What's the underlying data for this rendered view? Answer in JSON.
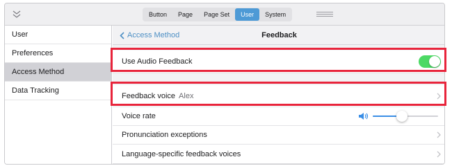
{
  "toolbar": {
    "segments": [
      "Button",
      "Page",
      "Page Set",
      "User",
      "System"
    ],
    "active_segment": "User"
  },
  "sidebar": {
    "items": [
      {
        "label": "User"
      },
      {
        "label": "Preferences"
      },
      {
        "label": "Access Method"
      },
      {
        "label": "Data Tracking"
      }
    ],
    "selected": "Access Method"
  },
  "nav": {
    "back_label": "Access Method",
    "title": "Feedback"
  },
  "settings": {
    "audio_feedback": {
      "label": "Use Audio Feedback",
      "enabled": true
    },
    "feedback_voice": {
      "label": "Feedback voice",
      "value": "Alex"
    },
    "voice_rate": {
      "label": "Voice rate",
      "level": 0.45
    },
    "pronunciation": {
      "label": "Pronunciation exceptions"
    },
    "language_voices": {
      "label": "Language-specific feedback voices"
    }
  },
  "colors": {
    "accent": "#4d9ad6",
    "toggle_on": "#4cd964",
    "highlight": "#e8243b"
  }
}
